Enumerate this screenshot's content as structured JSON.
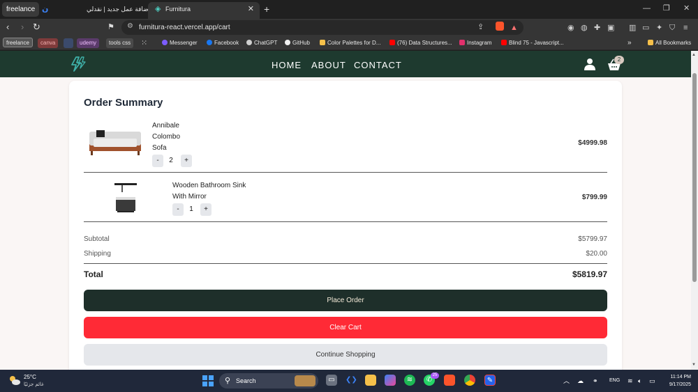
{
  "browser": {
    "tab_group": "freelance",
    "tabs": [
      {
        "title": "إضافة عمل جديد | نقدلي"
      },
      {
        "title": "Furnitura"
      }
    ],
    "url": "furnitura-react.vercel.app/cart",
    "bookmarks": {
      "freelance": "freelance",
      "canva": "canva",
      "udemy": "udemy",
      "tools_css": "tools css",
      "messenger": "Messenger",
      "facebook": "Facebook",
      "chatgpt": "ChatGPT",
      "github": "GitHub",
      "palettes": "Color Palettes for D...",
      "ds": "(76) Data Structures...",
      "instagram": "Instagram",
      "blind75": "Blind 75 - Javascript...",
      "all": "All Bookmarks"
    },
    "accent": "#353535"
  },
  "site": {
    "nav": {
      "home": "HOME",
      "about": "ABOUT",
      "contact": "CONTACT"
    },
    "cart_count": "2",
    "brand_color": "#1e3a2f"
  },
  "order": {
    "title": "Order Summary",
    "items": [
      {
        "name": "Annibale Colombo Sofa",
        "qty": "2",
        "price": "$4999.98",
        "minus": "-",
        "plus": "+"
      },
      {
        "name": "Wooden Bathroom Sink With Mirror",
        "qty": "1",
        "price": "$799.99",
        "minus": "-",
        "plus": "+"
      }
    ],
    "subtotal_label": "Subtotal",
    "subtotal": "$5799.97",
    "shipping_label": "Shipping",
    "shipping": "$20.00",
    "total_label": "Total",
    "total": "$5819.97",
    "place_order": "Place Order",
    "clear_cart": "Clear Cart",
    "continue": "Continue Shopping",
    "colors": {
      "place": "#1e2f2a",
      "clear": "#ff2a36",
      "continue": "#e5e7eb"
    }
  },
  "taskbar": {
    "temp": "25°C",
    "weather_desc": "غائم جزئيًا",
    "search": "Search",
    "whatsapp_badge": "25",
    "lang": "ENG",
    "time": "11:14 PM",
    "date": "9/17/2025"
  }
}
